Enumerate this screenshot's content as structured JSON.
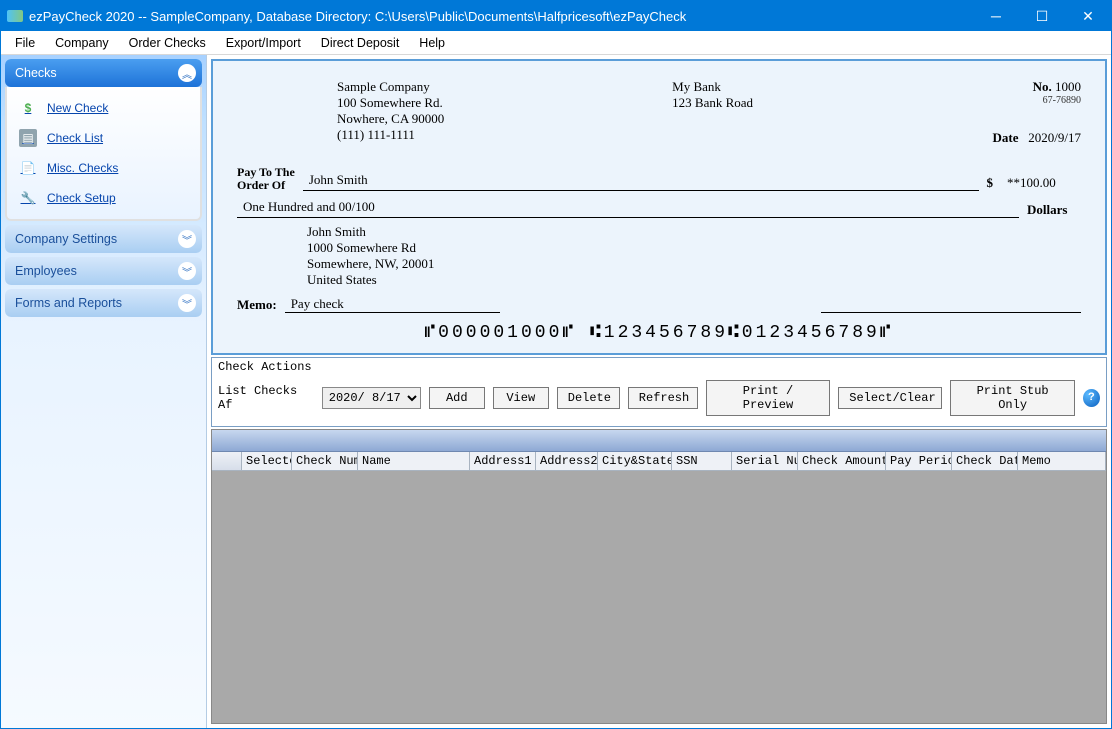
{
  "window": {
    "title": "ezPayCheck 2020 -- SampleCompany, Database Directory: C:\\Users\\Public\\Documents\\Halfpricesoft\\ezPayCheck"
  },
  "menu": [
    "File",
    "Company",
    "Order Checks",
    "Export/Import",
    "Direct Deposit",
    "Help"
  ],
  "sidebar": {
    "checks_label": "Checks",
    "items": [
      {
        "label": "New Check"
      },
      {
        "label": "Check List"
      },
      {
        "label": "Misc. Checks"
      },
      {
        "label": "Check Setup"
      }
    ],
    "panels": [
      {
        "label": "Company Settings"
      },
      {
        "label": "Employees"
      },
      {
        "label": "Forms and Reports"
      }
    ]
  },
  "check": {
    "company_name": "Sample Company",
    "company_addr1": "100 Somewhere Rd.",
    "company_addr2": "Nowhere, CA 90000",
    "company_phone": "(111) 111-1111",
    "bank_name": "My Bank",
    "bank_addr": "123 Bank Road",
    "no_label": "No.",
    "no_value": "1000",
    "routing_small": "67-76890",
    "date_label": "Date",
    "date_value": "2020/9/17",
    "pay_label1": "Pay To The",
    "pay_label2": "Order Of",
    "payee": "John Smith",
    "amount_symbol": "$",
    "amount": "**100.00",
    "amount_words": "One Hundred  and 00/100",
    "dollars_label": "Dollars",
    "payee_name": "John Smith",
    "payee_addr1": "1000 Somewhere Rd",
    "payee_addr2": "Somewhere, NW, 20001",
    "payee_country": "United States",
    "memo_label": "Memo:",
    "memo_value": "Pay check",
    "micr": "⑈000001000⑈ ⑆123456789⑆0123456789⑈"
  },
  "actions": {
    "title": "Check Actions",
    "list_label": "List Checks Af",
    "date": "2020/ 8/17",
    "buttons": [
      "Add",
      "View",
      "Delete",
      "Refresh",
      "Print / Preview",
      "Select/Clear",
      "Print Stub Only"
    ]
  },
  "grid": {
    "columns": [
      "Selecte",
      "Check Num",
      "Name",
      "Address1",
      "Address2",
      "City&State",
      "SSN",
      "Serial Nu",
      "Check Amount",
      "Pay Perio",
      "Check Dat",
      "Memo"
    ]
  }
}
